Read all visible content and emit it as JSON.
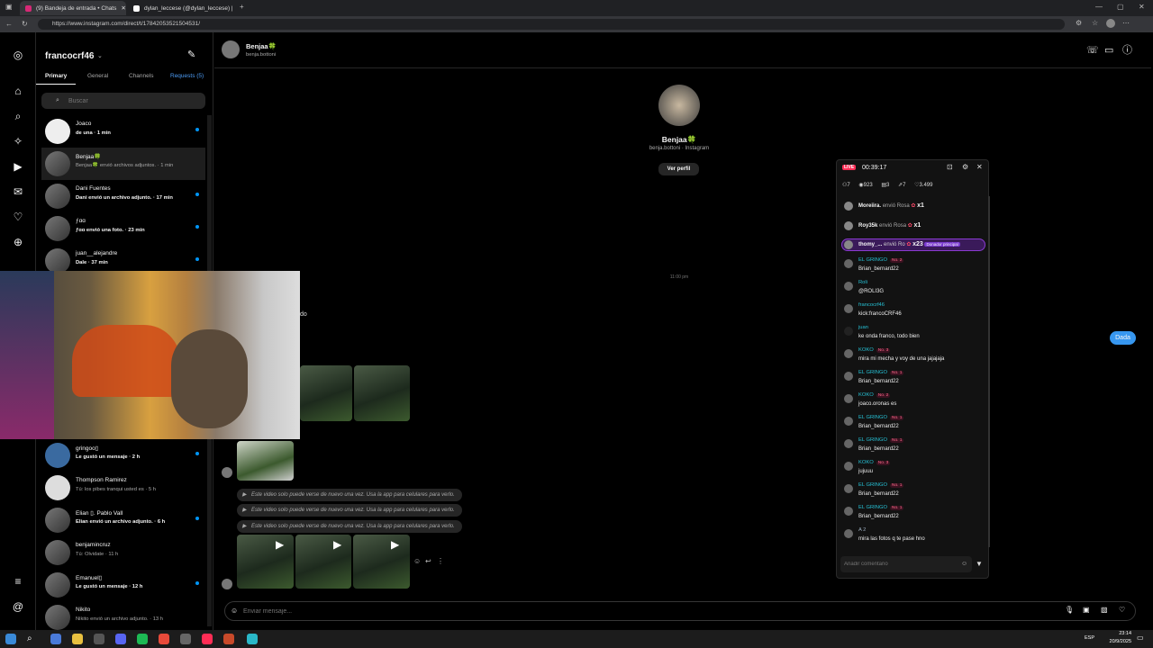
{
  "browser": {
    "tabs": [
      {
        "label": "(9) Bandeja de entrada • Chats",
        "active": true
      },
      {
        "label": "dylan_leccese (@dylan_leccese) |",
        "active": false
      }
    ],
    "url": "https://www.instagram.com/direct/t/17842053521504531/"
  },
  "inbox": {
    "username": "francocrf46",
    "tabs": [
      "Primary",
      "General",
      "Channels",
      "Requests (5)"
    ],
    "search_placeholder": "Buscar",
    "threads_top": [
      {
        "name": "Joaco",
        "sub": "de una · 1 min",
        "unread": true
      },
      {
        "name": "Benjaa🍀",
        "sub": "Benjaa🍀 envió archivos adjuntos. · 1 min",
        "unread": false
      },
      {
        "name": "Dani Fuentes",
        "sub": "Dani envió un archivo adjunto. · 17 min",
        "unread": true
      },
      {
        "name": "ƒɑɑ",
        "sub": "ƒɑɑ envió una foto. · 23 min",
        "unread": true
      },
      {
        "name": "juan__alejandre",
        "sub": "Dale · 37 min",
        "unread": true
      }
    ],
    "threads_bottom": [
      {
        "name": "gringoo▯",
        "sub": "Le gustó un mensaje · 2 h",
        "unread": true
      },
      {
        "name": "Thompson Ramirez",
        "sub": "Tú: los pibes tranqui usted es · 5 h",
        "unread": false
      },
      {
        "name": "Elian ▯. Pablo Vall",
        "sub": "Elian envió un archivo adjunto. · 6 h",
        "unread": true
      },
      {
        "name": "benjamincruz",
        "sub": "Tú: Olvidate · 11 h",
        "unread": false
      },
      {
        "name": "Emanuel▯",
        "sub": "Le gustó un mensaje · 12 h",
        "unread": true
      },
      {
        "name": "Nikito",
        "sub": "Nikito envió un archivo adjunto. · 13 h",
        "unread": false
      }
    ]
  },
  "conversation": {
    "header_name": "Benjaa🍀",
    "header_handle": "benja.bottoni",
    "profile_name": "Benjaa🍀",
    "profile_sub": "benja.bottoni · Instagram",
    "view_profile": "Ver perfil",
    "time_sep": "11:00 pm",
    "partial_text": "do",
    "outgoing_msg": "Dada",
    "sys_msg": "Este video solo puede verse de nuevo una vez. Usa la app para celulares para verlo.",
    "input_placeholder": "Enviar mensaje..."
  },
  "live": {
    "live_badge": "LIVE",
    "timer": "00:39:17",
    "stats": [
      "7",
      "923",
      "3",
      "7",
      "3.499"
    ],
    "gifts": [
      {
        "user": "Moreiira.",
        "text": "envió Rosa",
        "count": "x1"
      },
      {
        "user": "Roy35k",
        "text": "envió Rosa",
        "count": "x1"
      },
      {
        "user": "thomy_...",
        "text": "envió Ro",
        "count": "x23",
        "tag": "Donador principal"
      }
    ],
    "comments": [
      {
        "user": "EL GRINGO",
        "badge": "No. 2",
        "text": "Brian_bernard22"
      },
      {
        "user": "Roli",
        "badge": "",
        "text": "@ROLI3G"
      },
      {
        "user": "francocrf46",
        "badge": "",
        "text": "kick:francoCRF46"
      },
      {
        "user": "juan",
        "badge": "",
        "text": "ke onda franco, todo bien"
      },
      {
        "user": "KOKO",
        "badge": "No. 3",
        "text": "mira mi mecha y voy de una jajajaja"
      },
      {
        "user": "EL GRINGO",
        "badge": "No. 1",
        "text": "Brian_bernard22"
      },
      {
        "user": "KOKO",
        "badge": "No. 2",
        "text": "joaco.oronas es"
      },
      {
        "user": "EL GRINGO",
        "badge": "No. 1",
        "text": "Brian_bernard22"
      },
      {
        "user": "EL GRINGO",
        "badge": "No. 1",
        "text": "Brian_bernard22"
      },
      {
        "user": "KOKO",
        "badge": "No. 3",
        "text": "jujuuu"
      },
      {
        "user": "EL GRINGO",
        "badge": "No. 1",
        "text": "Brian_bernard22"
      },
      {
        "user": "EL GRINGO",
        "badge": "No. 1",
        "text": "Brian_bernard22"
      },
      {
        "user": "A 2",
        "badge": "",
        "text": "mira las fotos q te pase hno"
      }
    ],
    "comment_placeholder": "Añadir comentario"
  },
  "taskbar": {
    "lang": "ESP",
    "time": "23:14",
    "date": "20/9/2025"
  },
  "colors": {
    "accent": "#0095f6",
    "live": "#fe2c55",
    "bg": "#000000"
  }
}
